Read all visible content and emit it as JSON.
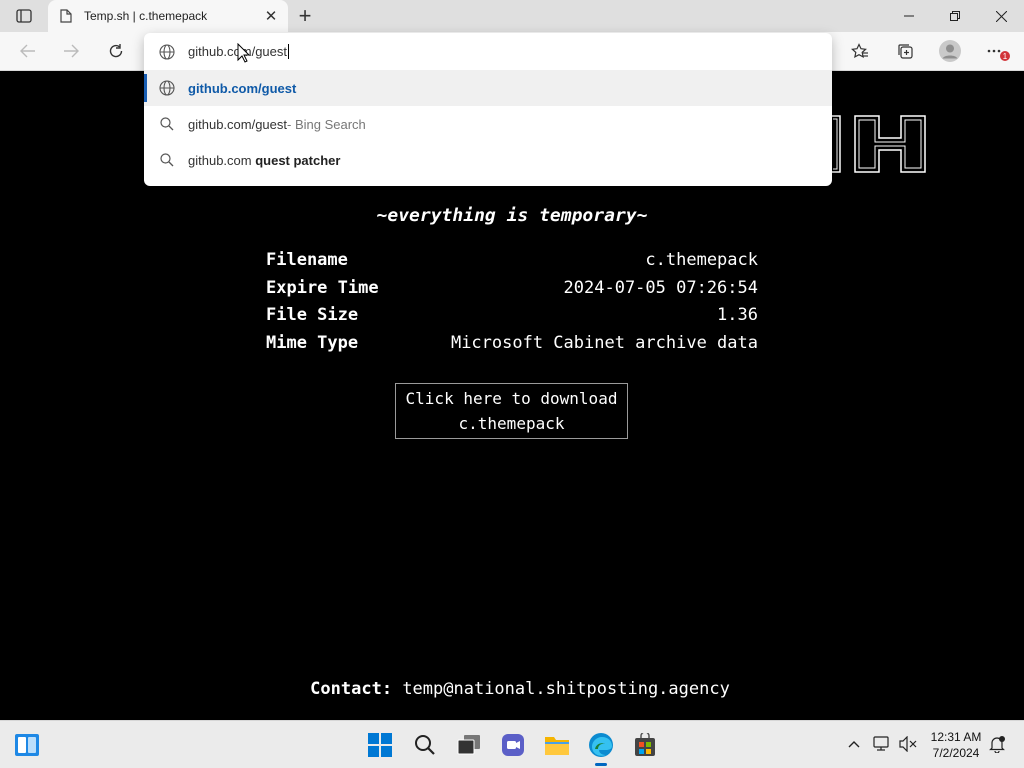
{
  "browser": {
    "tab_title": "Temp.sh | c.themepack",
    "new_tab_symbol": "+",
    "notification_count": "1"
  },
  "omnibox": {
    "value": "github.com/guest",
    "suggestions": [
      {
        "main": "github.com/guest",
        "suffix": "",
        "icon": "globe-icon"
      },
      {
        "main": "github.com/guest",
        "suffix": " - Bing Search",
        "icon": "search-icon"
      },
      {
        "main": "github.com ",
        "suffix": "quest patcher",
        "icon": "search-icon"
      }
    ]
  },
  "page": {
    "tagline": "~everything is temporary~",
    "info": [
      {
        "key": "Filename",
        "value": "c.themepack"
      },
      {
        "key": "Expire Time",
        "value": "2024-07-05 07:26:54"
      },
      {
        "key": "File Size",
        "value": "1.36"
      },
      {
        "key": "Mime Type",
        "value": "Microsoft Cabinet archive data"
      }
    ],
    "download_line1": "Click here to download",
    "download_line2": "c.themepack",
    "contact_label": "Contact:",
    "contact_email": "temp@national.shitposting.agency"
  },
  "taskbar": {
    "time": "12:31 AM",
    "date": "7/2/2024"
  },
  "colors": {
    "page_bg": "#000000",
    "accent": "#0067c0",
    "selected_suggestion": "#0f5aa8"
  }
}
